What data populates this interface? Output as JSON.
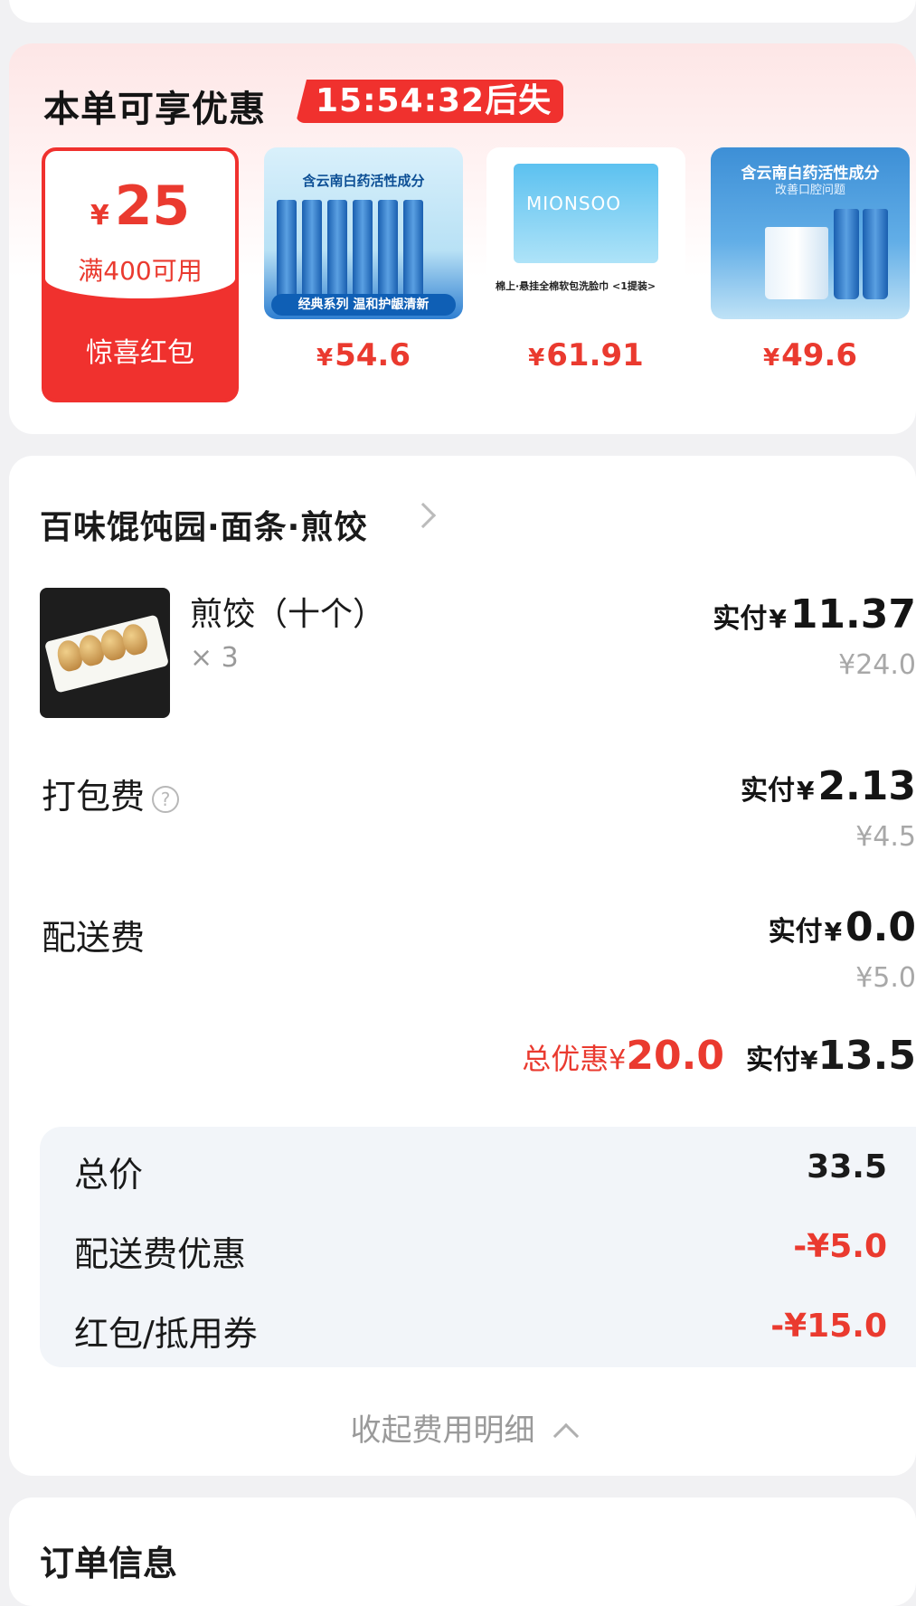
{
  "promo": {
    "title": "本单可享优惠",
    "timer": "15:54:32后失效",
    "coupon": {
      "currency": "¥",
      "amount": "25",
      "condition": "满400可用",
      "label": "惊喜红包"
    },
    "products": [
      {
        "currency": "¥",
        "price": "54.6",
        "image_caption": "含云南白药活性成分",
        "image_banner": "经典系列 温和护龈清新",
        "icon": "toothpaste-set-image"
      },
      {
        "currency": "¥",
        "price": "61.91",
        "image_brand": "MIONSOO",
        "image_text": "棉上·悬挂全棉软包洗脸巾 <1提装>",
        "icon": "face-towel-image"
      },
      {
        "currency": "¥",
        "price": "49.6",
        "image_caption": "含云南白药活性成分",
        "image_subcaption": "改善口腔问题",
        "icon": "toothpaste-pack-image"
      }
    ]
  },
  "order": {
    "store_name": "百味馄饨园·面条·煎饺",
    "item": {
      "name": "煎饺（十个）",
      "qty": "× 3",
      "paid_label": "实付",
      "currency": "¥",
      "paid": "11.37",
      "original": "¥24.0"
    },
    "packing": {
      "label": "打包费",
      "help_icon": "?",
      "paid_label": "实付",
      "currency": "¥",
      "paid": "2.13",
      "original": "¥4.5"
    },
    "delivery": {
      "label": "配送费",
      "paid_label": "实付",
      "currency": "¥",
      "paid": "0.0",
      "original": "¥5.0"
    },
    "summary": {
      "discount_label": "总优惠",
      "discount_currency": "¥",
      "discount": "20.0",
      "paid_label": "实付",
      "paid_currency": "¥",
      "paid": "13.5"
    },
    "breakdown": [
      {
        "label": "总价",
        "value": "33.5"
      },
      {
        "label": "配送费优惠",
        "value": "-¥5.0"
      },
      {
        "label": "红包/抵用券",
        "value": "-¥15.0"
      }
    ],
    "collapse_label": "收起费用明细"
  },
  "info": {
    "title": "订单信息"
  },
  "colors": {
    "accent_red": "#ea3a2f",
    "timer_red": "#f0312e",
    "breakdown_bg": "#f2f5f9"
  }
}
